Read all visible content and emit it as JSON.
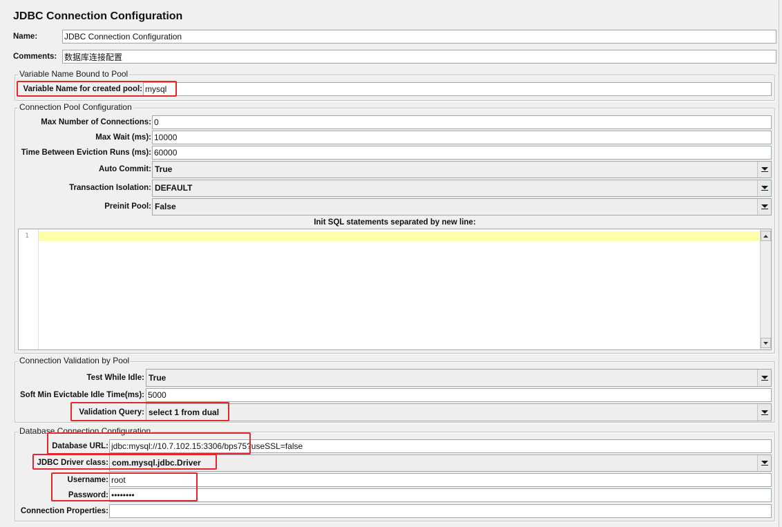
{
  "window": {
    "title": "JDBC Connection Configuration"
  },
  "name_field": {
    "label": "Name:",
    "value": "JDBC Connection Configuration"
  },
  "comments_field": {
    "label": "Comments:",
    "value": "数据库连接配置"
  },
  "variable_pool": {
    "legend": "Variable Name Bound to Pool",
    "variable_name": {
      "label": "Variable Name for created pool:",
      "value": "mysql"
    }
  },
  "pool_config": {
    "legend": "Connection Pool Configuration",
    "max_connections": {
      "label": "Max Number of Connections:",
      "value": "0"
    },
    "max_wait": {
      "label": "Max Wait (ms):",
      "value": "10000"
    },
    "eviction_runs": {
      "label": "Time Between Eviction Runs (ms):",
      "value": "60000"
    },
    "auto_commit": {
      "label": "Auto Commit:",
      "value": "True"
    },
    "transaction_isolation": {
      "label": "Transaction Isolation:",
      "value": "DEFAULT"
    },
    "preinit_pool": {
      "label": "Preinit Pool:",
      "value": "False"
    },
    "init_sql": {
      "label": "Init SQL statements separated by new line:",
      "line_numbers": [
        "1"
      ],
      "value": ""
    }
  },
  "validation": {
    "legend": "Connection Validation by Pool",
    "test_while_idle": {
      "label": "Test While Idle:",
      "value": "True"
    },
    "soft_min_idle": {
      "label": "Soft Min Evictable Idle Time(ms):",
      "value": "5000"
    },
    "validation_query": {
      "label": "Validation Query:",
      "value": "select 1 from dual"
    }
  },
  "database": {
    "legend": "Database Connection Configuration",
    "url": {
      "label": "Database URL:",
      "value": "jdbc:mysql://10.7.102.15:3306/bps75?useSSL=false"
    },
    "driver_class": {
      "label": "JDBC Driver class:",
      "value": "com.mysql.jdbc.Driver"
    },
    "username": {
      "label": "Username:",
      "value": "root"
    },
    "password": {
      "label": "Password:",
      "value": "••••••••"
    },
    "connection_properties": {
      "label": "Connection Properties:",
      "value": ""
    }
  },
  "icons": {
    "dropdown_arrow": "triangle-down-icon",
    "scroll_up": "triangle-up-icon",
    "scroll_down": "triangle-down-icon"
  },
  "colors": {
    "background": "#f0f0f0",
    "field_background": "#ffffff",
    "combo_background": "#eeeeee",
    "current_line_highlight": "#ffffaa",
    "annotation_red": "#e3262e"
  }
}
